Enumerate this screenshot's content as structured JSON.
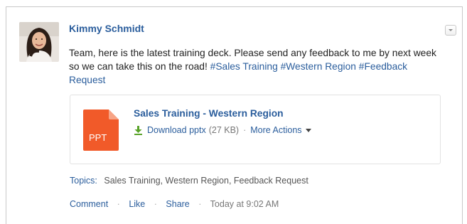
{
  "post": {
    "author": "Kimmy Schmidt",
    "body_text": "Team, here is the latest training deck. Please send any feedback to me by next week so we can take this on the road! ",
    "hashtags": [
      "#Sales Training",
      "#Western Region",
      "#Feedback Request"
    ]
  },
  "attachment": {
    "title": "Sales Training - Western Region",
    "file_type_label": "PPT",
    "download_label": "Download pptx",
    "file_size": "(27 KB)",
    "more_actions_label": "More Actions",
    "icon_color": "#f15a29"
  },
  "topics": {
    "label": "Topics:",
    "values": "Sales Training, Western Region, Feedback Request"
  },
  "footer": {
    "comment_label": "Comment",
    "like_label": "Like",
    "share_label": "Share",
    "timestamp": "Today at 9:02 AM"
  },
  "colors": {
    "link": "#2a5d9c",
    "text": "#222222",
    "muted": "#777777",
    "download_green": "#5aa32a"
  },
  "icons": {
    "menu": "chevron-down-icon",
    "download": "download-icon",
    "file": "ppt-file-icon"
  }
}
